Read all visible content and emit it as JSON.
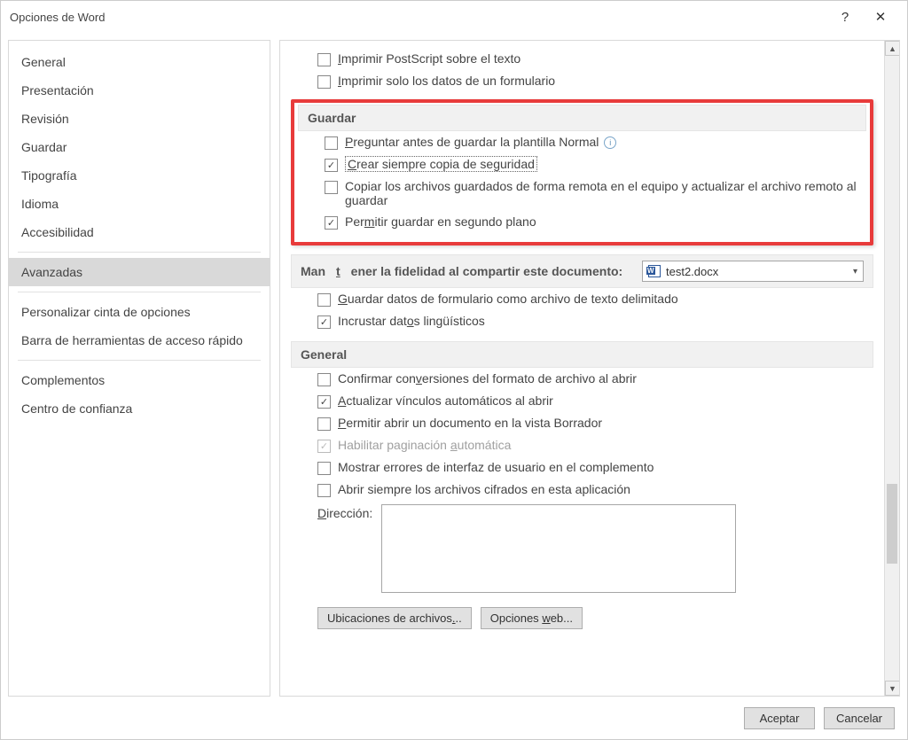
{
  "title": "Opciones de Word",
  "titlebar": {
    "help": "?",
    "close": "✕"
  },
  "sidebar": {
    "groups": [
      [
        "General",
        "Presentación",
        "Revisión",
        "Guardar",
        "Tipografía",
        "Idioma",
        "Accesibilidad"
      ],
      [
        "Avanzadas"
      ],
      [
        "Personalizar cinta de opciones",
        "Barra de herramientas de acceso rápido"
      ],
      [
        "Complementos",
        "Centro de confianza"
      ]
    ],
    "selected": "Avanzadas"
  },
  "topchecks": [
    {
      "label_pre": "I",
      "label": "mprimir PostScript sobre el texto",
      "checked": false
    },
    {
      "label_pre": "I",
      "label": "mprimir solo los datos de un formulario",
      "checked": false
    }
  ],
  "guardar": {
    "title": "Guardar",
    "items": [
      {
        "pre": "P",
        "text": "reguntar antes de guardar la plantilla Normal",
        "checked": false,
        "info": true
      },
      {
        "pre": "C",
        "text": "rear siempre copia de seguridad",
        "checked": true,
        "focused": true
      },
      {
        "text": "Copiar los archivos guardados de forma remota en el equipo y actualizar el archivo remoto al guardar",
        "checked": false
      },
      {
        "pre": "",
        "mid_u": "m",
        "before": "Per",
        "after": "itir guardar en segundo plano",
        "checked": true
      }
    ]
  },
  "fidelidad": {
    "title_before": "Man",
    "title_u": "t",
    "title_after": "ener la fidelidad al compartir este documento:",
    "dropdown": "test2.docx",
    "items": [
      {
        "pre": "G",
        "text": "uardar datos de formulario como archivo de texto delimitado",
        "checked": false
      },
      {
        "before": "Incrustar dat",
        "u": "o",
        "after": "s lingüísticos",
        "checked": true
      }
    ]
  },
  "general": {
    "title": "General",
    "items": [
      {
        "before": "Confirmar con",
        "u": "v",
        "after": "ersiones del formato de archivo al abrir",
        "checked": false
      },
      {
        "pre": "A",
        "text": "ctualizar vínculos automáticos al abrir",
        "checked": true
      },
      {
        "pre": "P",
        "text": "ermitir abrir un documento en la vista Borrador",
        "checked": false
      },
      {
        "before": "Habilitar paginación ",
        "u": "a",
        "after": "utomática",
        "checked": true,
        "disabled": true
      },
      {
        "text": "Mostrar errores de interfaz de usuario en el complemento",
        "checked": false
      },
      {
        "text": "Abrir siempre los archivos cifrados en esta aplicación",
        "checked": false
      }
    ],
    "address_label_pre": "D",
    "address_label": "irección:",
    "btn1_before": "Ubicaciones de archivos",
    "btn1_u": ".",
    "btn1_after": "..",
    "btn2_before": "Opciones ",
    "btn2_u": "w",
    "btn2_after": "eb..."
  },
  "footer": {
    "ok": "Aceptar",
    "cancel": "Cancelar"
  }
}
